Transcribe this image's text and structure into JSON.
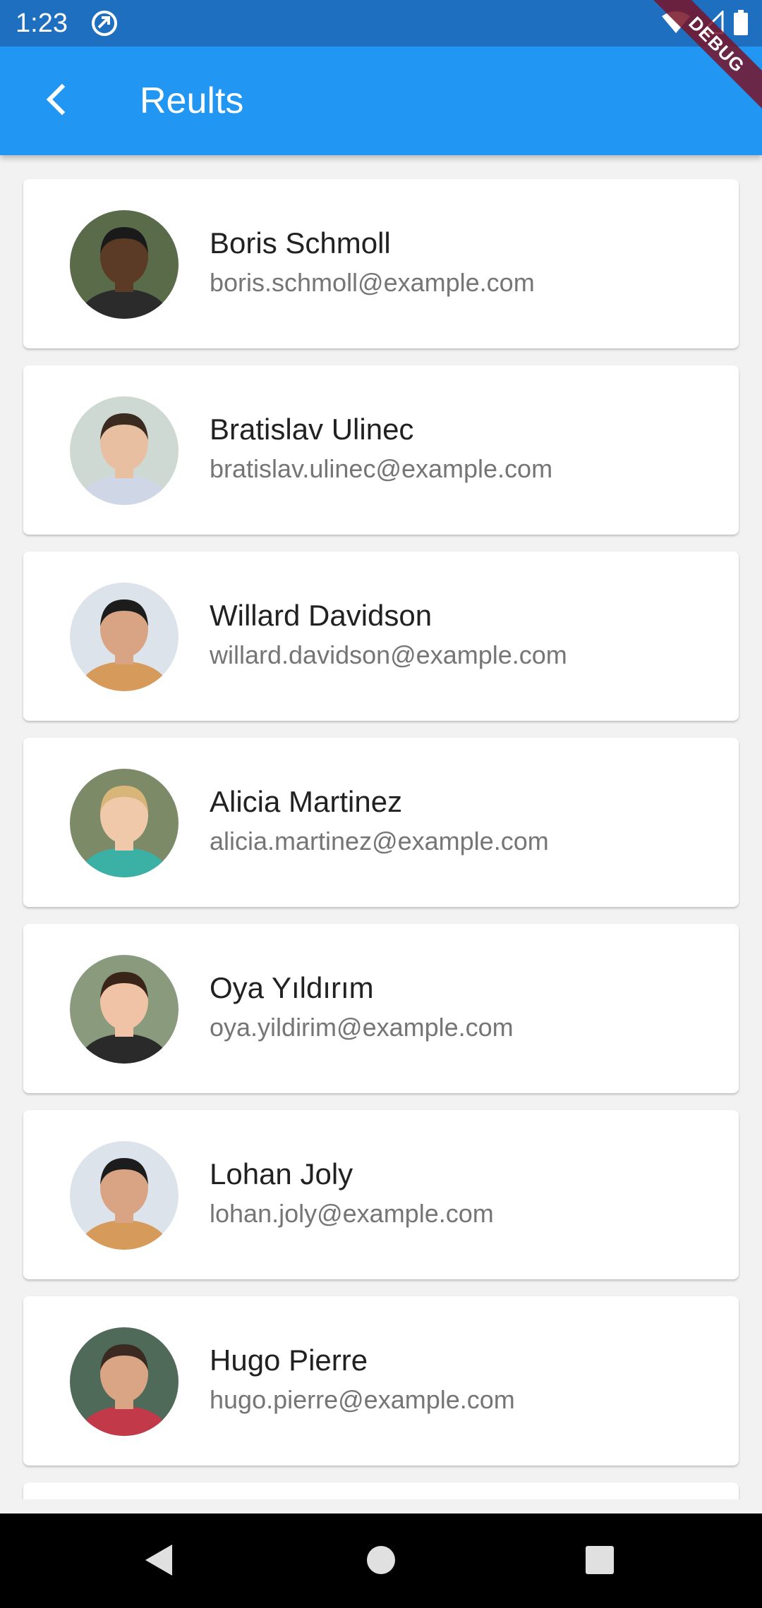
{
  "status_bar": {
    "time": "1:23",
    "icons": [
      "app-notification-icon",
      "wifi-icon",
      "cell-signal-icon",
      "battery-icon"
    ]
  },
  "debug_banner": {
    "label": "DEBUG"
  },
  "app_bar": {
    "title": "Reults",
    "color": "#2196f3",
    "back_icon": "chevron-left-icon"
  },
  "results": [
    {
      "name": "Boris Schmoll",
      "email": "boris.schmoll@example.com",
      "avatar": {
        "skin": "#5b3a26",
        "hair": "#1a1a1a",
        "shirt": "#2b2b2b",
        "bg": "#5a6b4a"
      }
    },
    {
      "name": "Bratislav Ulinec",
      "email": "bratislav.ulinec@example.com",
      "avatar": {
        "skin": "#e8bfa0",
        "hair": "#3b2a1f",
        "shirt": "#cfd6e6",
        "bg": "#cfd9d4"
      }
    },
    {
      "name": "Willard Davidson",
      "email": "willard.davidson@example.com",
      "avatar": {
        "skin": "#d8a483",
        "hair": "#1c1c1c",
        "shirt": "#d69a5a",
        "bg": "#dde3ea"
      }
    },
    {
      "name": "Alicia Martinez",
      "email": "alicia.martinez@example.com",
      "avatar": {
        "skin": "#f0c9aa",
        "hair": "#d8b67a",
        "shirt": "#3bb0a5",
        "bg": "#7c8a68"
      }
    },
    {
      "name": "Oya Yıldırım",
      "email": "oya.yildirim@example.com",
      "avatar": {
        "skin": "#f0c3a6",
        "hair": "#3a2418",
        "shirt": "#2a2a2a",
        "bg": "#8a9a7c"
      }
    },
    {
      "name": "Lohan Joly",
      "email": "lohan.joly@example.com",
      "avatar": {
        "skin": "#d8a483",
        "hair": "#1c1c1c",
        "shirt": "#d69a5a",
        "bg": "#dde3ea"
      }
    },
    {
      "name": "Hugo Pierre",
      "email": "hugo.pierre@example.com",
      "avatar": {
        "skin": "#d9a585",
        "hair": "#3a2a22",
        "shirt": "#c23a4a",
        "bg": "#4f6a58"
      }
    }
  ],
  "nav_bar": {
    "buttons": [
      "back-triangle-icon",
      "home-circle-icon",
      "recents-square-icon"
    ]
  }
}
